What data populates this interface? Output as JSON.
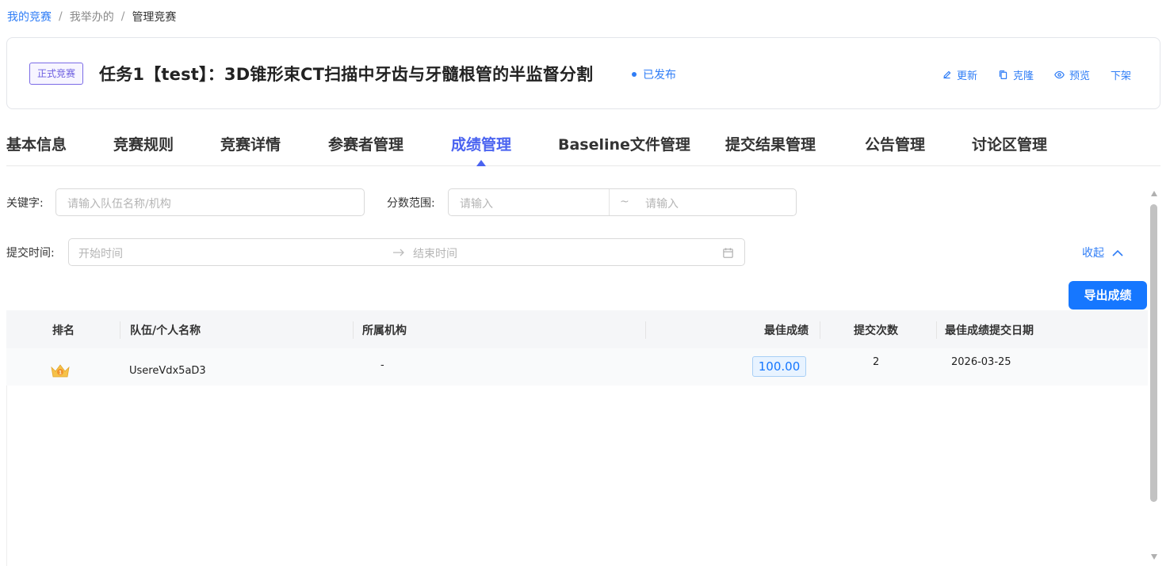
{
  "breadcrumb": {
    "home": "我的竞赛",
    "mid": "我举办的",
    "current": "管理竞赛",
    "sep": "/"
  },
  "header": {
    "tag": "正式竞赛",
    "title": "任务1【test】：3D锥形束CT扫描中牙齿与牙髓根管的半监督分割",
    "status": "已发布",
    "actions": {
      "update": "更新",
      "clone": "克隆",
      "preview": "预览",
      "unpublish": "下架"
    }
  },
  "tabs": [
    "基本信息",
    "竞赛规则",
    "竞赛详情",
    "参赛者管理",
    "成绩管理",
    "Baseline文件管理",
    "提交结果管理",
    "公告管理",
    "讨论区管理"
  ],
  "active_tab": "成绩管理",
  "filters": {
    "keyword_label": "关键字:",
    "keyword_placeholder": "请输入队伍名称/机构",
    "score_label": "分数范围:",
    "score_min_placeholder": "请输入",
    "score_sep": "~",
    "score_max_placeholder": "请输入",
    "time_label": "提交时间:",
    "start_placeholder": "开始时间",
    "end_placeholder": "结束时间",
    "collapse_label": "收起"
  },
  "export_label": "导出成绩",
  "table": {
    "columns": [
      "排名",
      "队伍/个人名称",
      "所属机构",
      "最佳成绩",
      "提交次数",
      "最佳成绩提交日期"
    ],
    "rows": [
      {
        "rank_icon": "gold-medal-icon",
        "rank": "1",
        "name": "UsereVdx5aD3",
        "org": "-",
        "score": "100.00",
        "submissions": "2",
        "date": "2026-03-25"
      }
    ]
  },
  "colors": {
    "primary": "#1677ff",
    "tab_active": "#4a63f0",
    "tag": "#6b5de0"
  }
}
